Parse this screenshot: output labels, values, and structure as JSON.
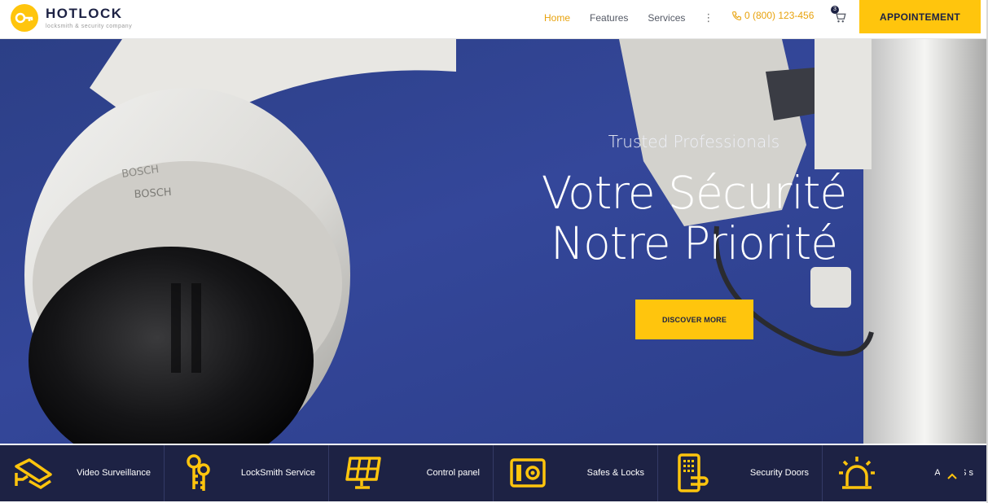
{
  "brand": {
    "name": "HOTLOCK",
    "tagline": "locksmith & security company",
    "accent": "#ffc50d",
    "navy": "#1d2244"
  },
  "nav": {
    "items": [
      {
        "label": "Home",
        "active": true
      },
      {
        "label": "Features",
        "active": false
      },
      {
        "label": "Services",
        "active": false
      }
    ],
    "more": "⋮"
  },
  "phone": "0 (800) 123-456",
  "cart": {
    "count": "3"
  },
  "cta": {
    "appointment": "APPOINTEMENT"
  },
  "hero": {
    "subtitle": "Trusted Professionals",
    "title_line1": "Votre Sécurité",
    "title_line2": "Notre Priorité",
    "button": "DISCOVER MORE",
    "camera_brand": "BOSCH"
  },
  "services": [
    {
      "label": "Video Surveillance",
      "icon": "camera-icon"
    },
    {
      "label": "LockSmith Service",
      "icon": "keys-icon"
    },
    {
      "label": "Control panel",
      "icon": "panel-icon"
    },
    {
      "label": "Safes & Locks",
      "icon": "safe-icon"
    },
    {
      "label": "Security Doors",
      "icon": "door-keypad-icon"
    },
    {
      "label": "Alarm S   s",
      "icon": "alarm-icon"
    }
  ]
}
